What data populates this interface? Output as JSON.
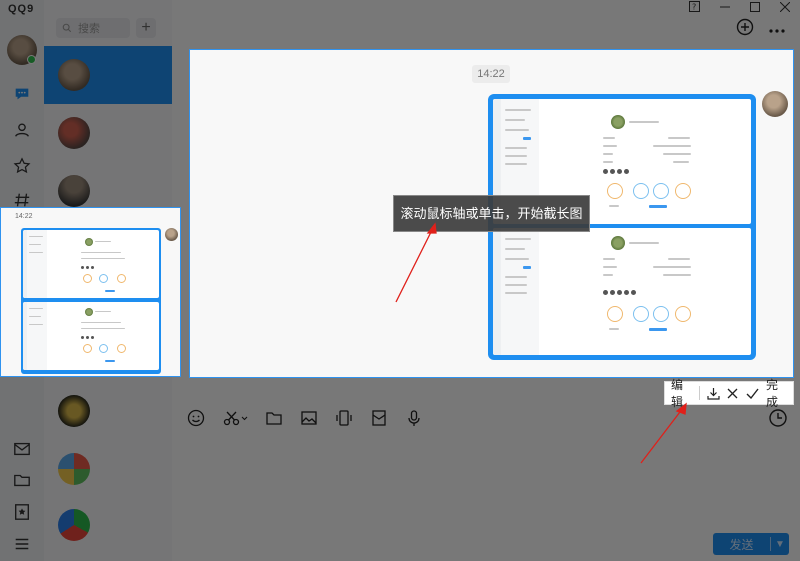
{
  "app": {
    "logo": "QQ9"
  },
  "search": {
    "placeholder": "搜索"
  },
  "capture": {
    "timestamp": "14:22",
    "tooltip": "滚动鼠标轴或单击，开始截长图"
  },
  "thumbnail": {
    "timestamp": "14:22"
  },
  "edit_toolbar": {
    "edit_label": "编辑",
    "done_label": "完成"
  },
  "send": {
    "label": "发送"
  },
  "colors": {
    "accent": "#1e8ef0",
    "capture_border": "#2f93f0",
    "arrow": "#e0201a"
  }
}
